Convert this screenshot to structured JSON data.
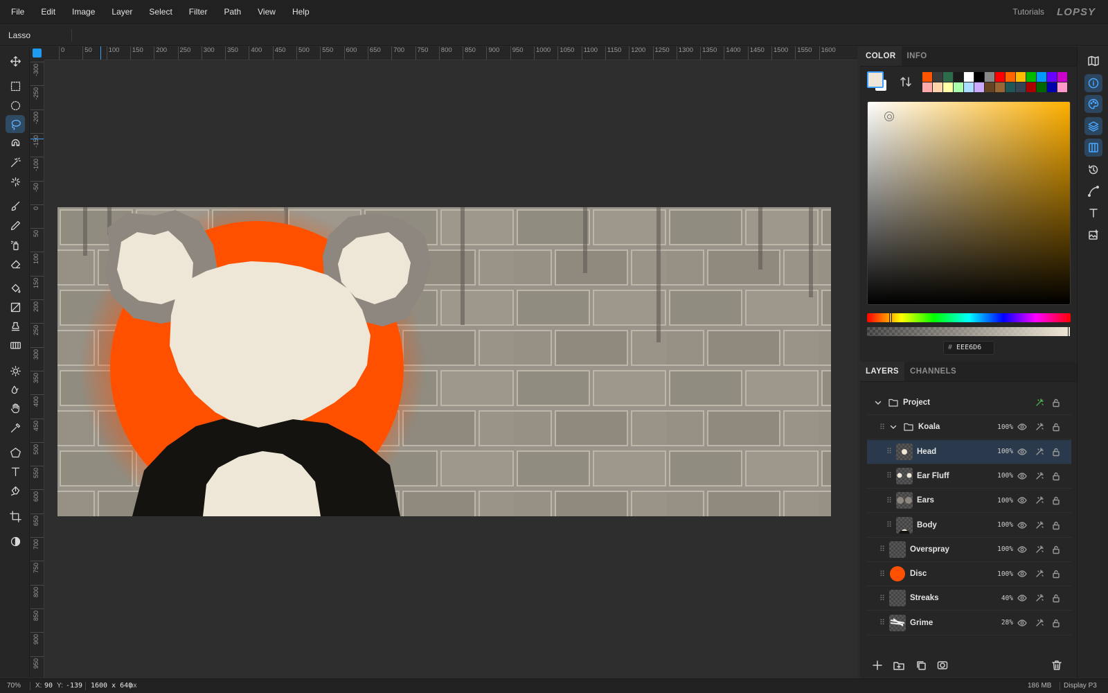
{
  "menu": [
    "File",
    "Edit",
    "Image",
    "Layer",
    "Select",
    "Filter",
    "Path",
    "View",
    "Help"
  ],
  "header": {
    "tutorials": "Tutorials",
    "logo": "LOPSY"
  },
  "options": {
    "tool_name": "Lasso"
  },
  "tools": [
    {
      "name": "move-tool",
      "icon": "move-icon"
    },
    {
      "name": "rect-select-tool",
      "icon": "rect-select-icon"
    },
    {
      "name": "ellipse-select-tool",
      "icon": "ellipse-select-icon"
    },
    {
      "name": "lasso-tool",
      "icon": "lasso-icon",
      "active": true
    },
    {
      "name": "magnetic-lasso-tool",
      "icon": "magnet-icon"
    },
    {
      "name": "magic-wand-tool",
      "icon": "magic-wand-icon"
    },
    {
      "name": "quick-select-tool",
      "icon": "sparkle-icon"
    },
    {
      "name": "brush-tool",
      "icon": "brush-icon"
    },
    {
      "name": "pencil-tool",
      "icon": "pencil-icon"
    },
    {
      "name": "spray-tool",
      "icon": "spray-icon"
    },
    {
      "name": "eraser-tool",
      "icon": "eraser-icon"
    },
    {
      "name": "fill-tool",
      "icon": "bucket-icon"
    },
    {
      "name": "gradient-tool",
      "icon": "gradient-icon"
    },
    {
      "name": "stamp-tool",
      "icon": "stamp-icon"
    },
    {
      "name": "pattern-tool",
      "icon": "pattern-icon"
    },
    {
      "name": "dodge-tool",
      "icon": "sun-icon"
    },
    {
      "name": "blur-tool",
      "icon": "drops-icon"
    },
    {
      "name": "smudge-tool",
      "icon": "hand-icon"
    },
    {
      "name": "eyedropper-tool",
      "icon": "eyedropper-icon"
    },
    {
      "name": "shape-tool",
      "icon": "pentagon-icon"
    },
    {
      "name": "text-tool",
      "icon": "text-icon"
    },
    {
      "name": "pen-tool",
      "icon": "pen-icon"
    },
    {
      "name": "crop-tool",
      "icon": "crop-icon"
    },
    {
      "name": "mask-tool",
      "icon": "contrast-icon"
    }
  ],
  "ruler": {
    "h": [
      "0",
      "50",
      "100",
      "150",
      "200",
      "250",
      "300",
      "350",
      "400",
      "450",
      "500",
      "550",
      "600",
      "650",
      "700",
      "750",
      "800",
      "850",
      "900",
      "950",
      "1000",
      "1050",
      "1100",
      "1150",
      "1200",
      "1250",
      "1300",
      "1350",
      "1400",
      "1450",
      "1500",
      "1550",
      "1600"
    ],
    "v": [
      "-300",
      "-250",
      "-200",
      "-150",
      "-100",
      "-50",
      "0",
      "50",
      "100",
      "150",
      "200",
      "250",
      "300",
      "350",
      "400",
      "450",
      "500",
      "550",
      "600",
      "650",
      "700",
      "750",
      "800",
      "850",
      "900",
      "950"
    ]
  },
  "color_panel": {
    "tabs": [
      "COLOR",
      "INFO"
    ],
    "foreground": "#eee6d6",
    "background": "#ffffff",
    "palette": [
      "#ff5500",
      "#3a3a3a",
      "#2e6b4a",
      "#1a1a1a",
      "#ffffff",
      "#000000",
      "#888888",
      "#ff0000",
      "#ff6600",
      "#ffbb00",
      "#00bb00",
      "#0099ff",
      "#6600ff",
      "#cc00cc",
      "#ffaaaa",
      "#ffd4aa",
      "#ffffaa",
      "#aaffaa",
      "#aaddff",
      "#ccaaff",
      "#664422",
      "#996633",
      "#225555",
      "#334455",
      "#aa0000",
      "#006600",
      "#0000aa",
      "#ff99cc"
    ],
    "hue_color": "#ffb000",
    "hex_label": "#",
    "hex": "EEE6D6"
  },
  "layers_panel": {
    "tabs": [
      "LAYERS",
      "CHANNELS"
    ],
    "layers": [
      {
        "name": "Project",
        "opacity": "",
        "depth": 0,
        "type": "group"
      },
      {
        "name": "Koala",
        "opacity": "100%",
        "depth": 1,
        "type": "group"
      },
      {
        "name": "Head",
        "opacity": "100%",
        "depth": 2,
        "type": "layer",
        "selected": true
      },
      {
        "name": "Ear Fluff",
        "opacity": "100%",
        "depth": 2,
        "type": "layer"
      },
      {
        "name": "Ears",
        "opacity": "100%",
        "depth": 2,
        "type": "layer"
      },
      {
        "name": "Body",
        "opacity": "100%",
        "depth": 2,
        "type": "layer"
      },
      {
        "name": "Overspray",
        "opacity": "100%",
        "depth": 1,
        "type": "layer"
      },
      {
        "name": "Disc",
        "opacity": "100%",
        "depth": 1,
        "type": "layer"
      },
      {
        "name": "Streaks",
        "opacity": "40%",
        "depth": 1,
        "type": "layer"
      },
      {
        "name": "Grime",
        "opacity": "28%",
        "depth": 1,
        "type": "layer"
      }
    ]
  },
  "status": {
    "zoom": "70%",
    "x_label": "X:",
    "x": "90",
    "y_label": "Y:",
    "y": "-139",
    "size": "1600 x 640",
    "unit": "px",
    "memory": "186 MB",
    "display": "Display P3"
  },
  "colors": {
    "accent": "#1e9bf0",
    "disc": "#ff5000",
    "cream": "#eee6d6",
    "ear_gray": "#8d8780",
    "body": "#151310",
    "wall": "#a39e92"
  }
}
